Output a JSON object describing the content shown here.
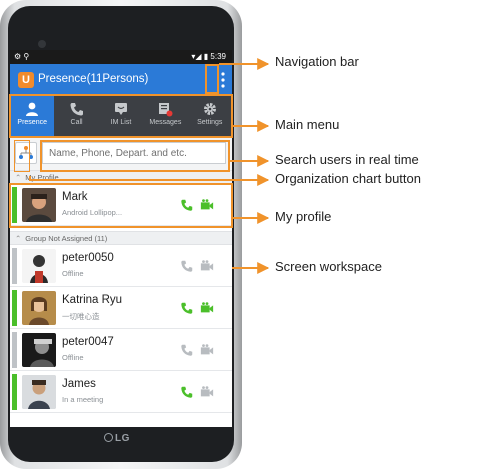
{
  "status_bar": {
    "time": "5:39"
  },
  "app": {
    "title": "Presence(11Persons)",
    "logo_glyph": "U",
    "overflow_glyph": "⋮",
    "brand_color": "#2b7ad7",
    "accent_color": "#f08b2c"
  },
  "menu": {
    "items": [
      {
        "label": "Presence",
        "icon": "person-icon",
        "active": true
      },
      {
        "label": "Call",
        "icon": "phone-icon",
        "active": false
      },
      {
        "label": "IM List",
        "icon": "chat-icon",
        "active": false
      },
      {
        "label": "Messages",
        "icon": "messages-icon",
        "active": false
      },
      {
        "label": "Settings",
        "icon": "gear-icon",
        "active": false
      }
    ]
  },
  "search": {
    "placeholder": "Name, Phone, Depart. and etc."
  },
  "sections": {
    "my_profile": "My Profile",
    "group": "Group Not Assigned",
    "group_count": "(11)"
  },
  "my_profile": {
    "name": "Mark",
    "status": "Android Lollipop...",
    "presence_color": "#4bbf2a"
  },
  "contacts": [
    {
      "name": "peter0050",
      "status": "Offline",
      "presence_color": "#bfc3c7"
    },
    {
      "name": "Katrina Ryu",
      "status": "一切唯心造",
      "presence_color": "#4bbf2a"
    },
    {
      "name": "peter0047",
      "status": "Offline",
      "presence_color": "#bfc3c7"
    },
    {
      "name": "James",
      "status": "In a meeting",
      "presence_color": "#4bbf2a"
    }
  ],
  "brand": {
    "phone_logo": "LG"
  },
  "callouts": {
    "navigation_bar": "Navigation bar",
    "main_menu": "Main menu",
    "search": "Search users in real time",
    "org_chart": "Organization chart button",
    "my_profile": "My profile",
    "workspace": "Screen workspace"
  }
}
